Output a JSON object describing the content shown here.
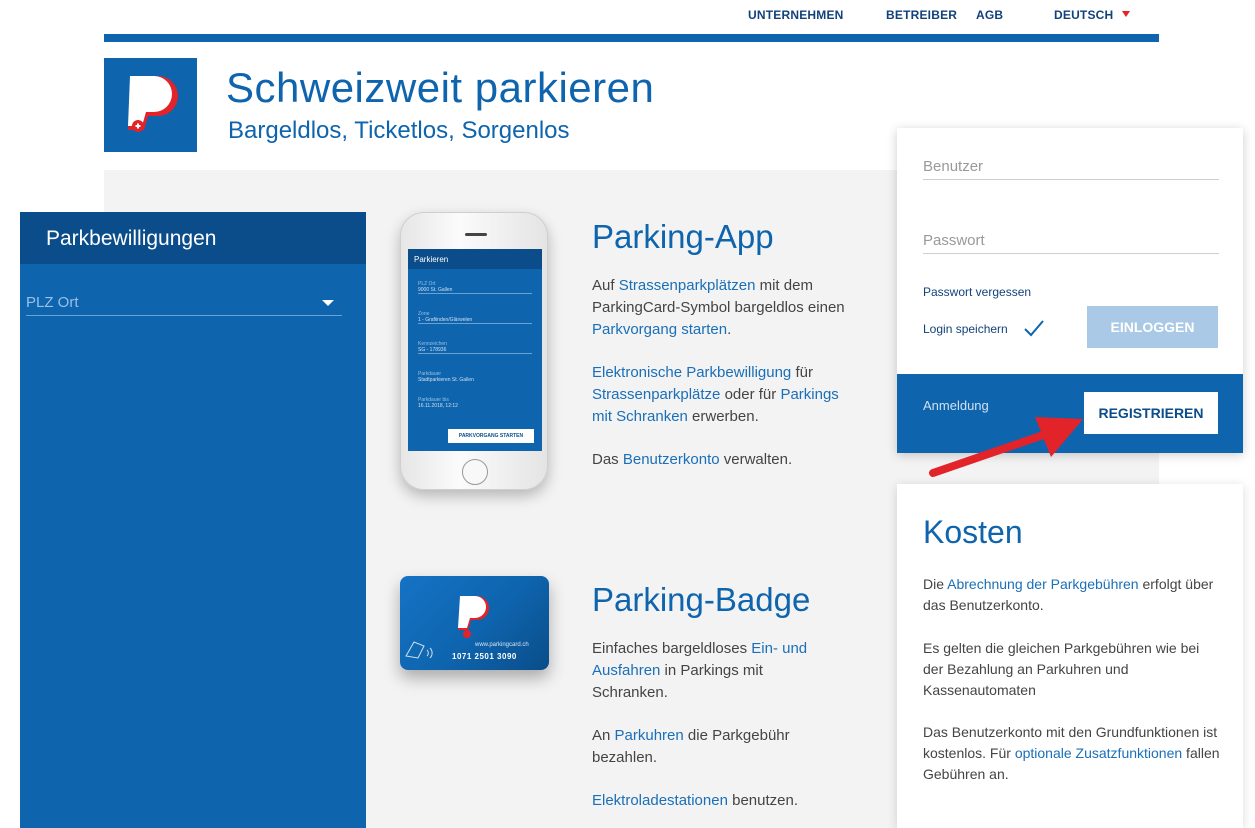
{
  "nav": {
    "items": [
      "UNTERNEHMEN",
      "BETREIBER",
      "AGB",
      "DEUTSCH"
    ]
  },
  "colors": {
    "brand_blue": "#0e64ad",
    "dark_blue": "#0a4d8a",
    "accent_red": "#e3232a"
  },
  "header": {
    "title": "Schweizweit parkieren",
    "subtitle": "Bargeldlos, Ticketlos, Sorgenlos",
    "logo_icon": "parkingcard-logo-icon"
  },
  "sidebar": {
    "title": "Parkbewilligungen",
    "select_placeholder": "PLZ Ort"
  },
  "phone": {
    "screen_title": "Parkieren",
    "rows": [
      {
        "label": "PLZ Ort",
        "value": "9000 St. Gallen"
      },
      {
        "label": "Zone",
        "value": "1 - Grafiinden/Glärwelen"
      },
      {
        "label": "Kennzeichen",
        "value": "SG - 178936"
      },
      {
        "label": "Parkdauer",
        "value": "Stadtparkieren St. Gallen"
      },
      {
        "label": "Parkdauer bis",
        "value": "16.11.2018, 12:12"
      }
    ],
    "button": "PARKVORGANG STARTEN"
  },
  "badge": {
    "url": "www.parkingcard.ch",
    "number": "1071 2501 3090"
  },
  "app_section": {
    "title": "Parking-App",
    "p1": [
      "Auf ",
      "Strassenparkplätzen",
      " mit dem ParkingCard-Symbol bargeldlos einen ",
      "Parkvorgang starten",
      "."
    ],
    "p2": [
      "Elektronische Parkbewilligung",
      " für ",
      "Strassenparkplätze",
      " oder für ",
      "Parkings mit Schranken",
      " erwerben."
    ],
    "p3": [
      "Das ",
      "Benutzerkonto",
      " verwalten."
    ]
  },
  "badge_section": {
    "title": "Parking-Badge",
    "p1": [
      "Einfaches bargeldloses ",
      "Ein- und Ausfahren",
      " in Parkings mit Schranken."
    ],
    "p2": [
      "An ",
      "Parkuhren",
      " die Parkgebühr bezahlen."
    ],
    "p3": [
      "Elektroladestationen",
      " benutzen."
    ]
  },
  "login": {
    "user_placeholder": "Benutzer",
    "password_placeholder": "Passwort",
    "forgot": "Passwort vergessen",
    "remember": "Login speichern",
    "login_button": "EINLOGGEN",
    "register_label": "Anmeldung",
    "register_button": "REGISTRIEREN"
  },
  "kosten": {
    "title": "Kosten",
    "p1": [
      "Die ",
      "Abrechnung der Parkgebühren",
      " erfolgt über das Benutzerkonto."
    ],
    "p2": "Es gelten die gleichen Parkgebühren wie bei der Bezahlung an Parkuhren und Kassenautomaten",
    "p3": [
      "Das Benutzerkonto mit den Grundfunktionen ist kostenlos. Für ",
      "optionale Zusatzfunktionen",
      " fallen Gebühren an."
    ]
  }
}
